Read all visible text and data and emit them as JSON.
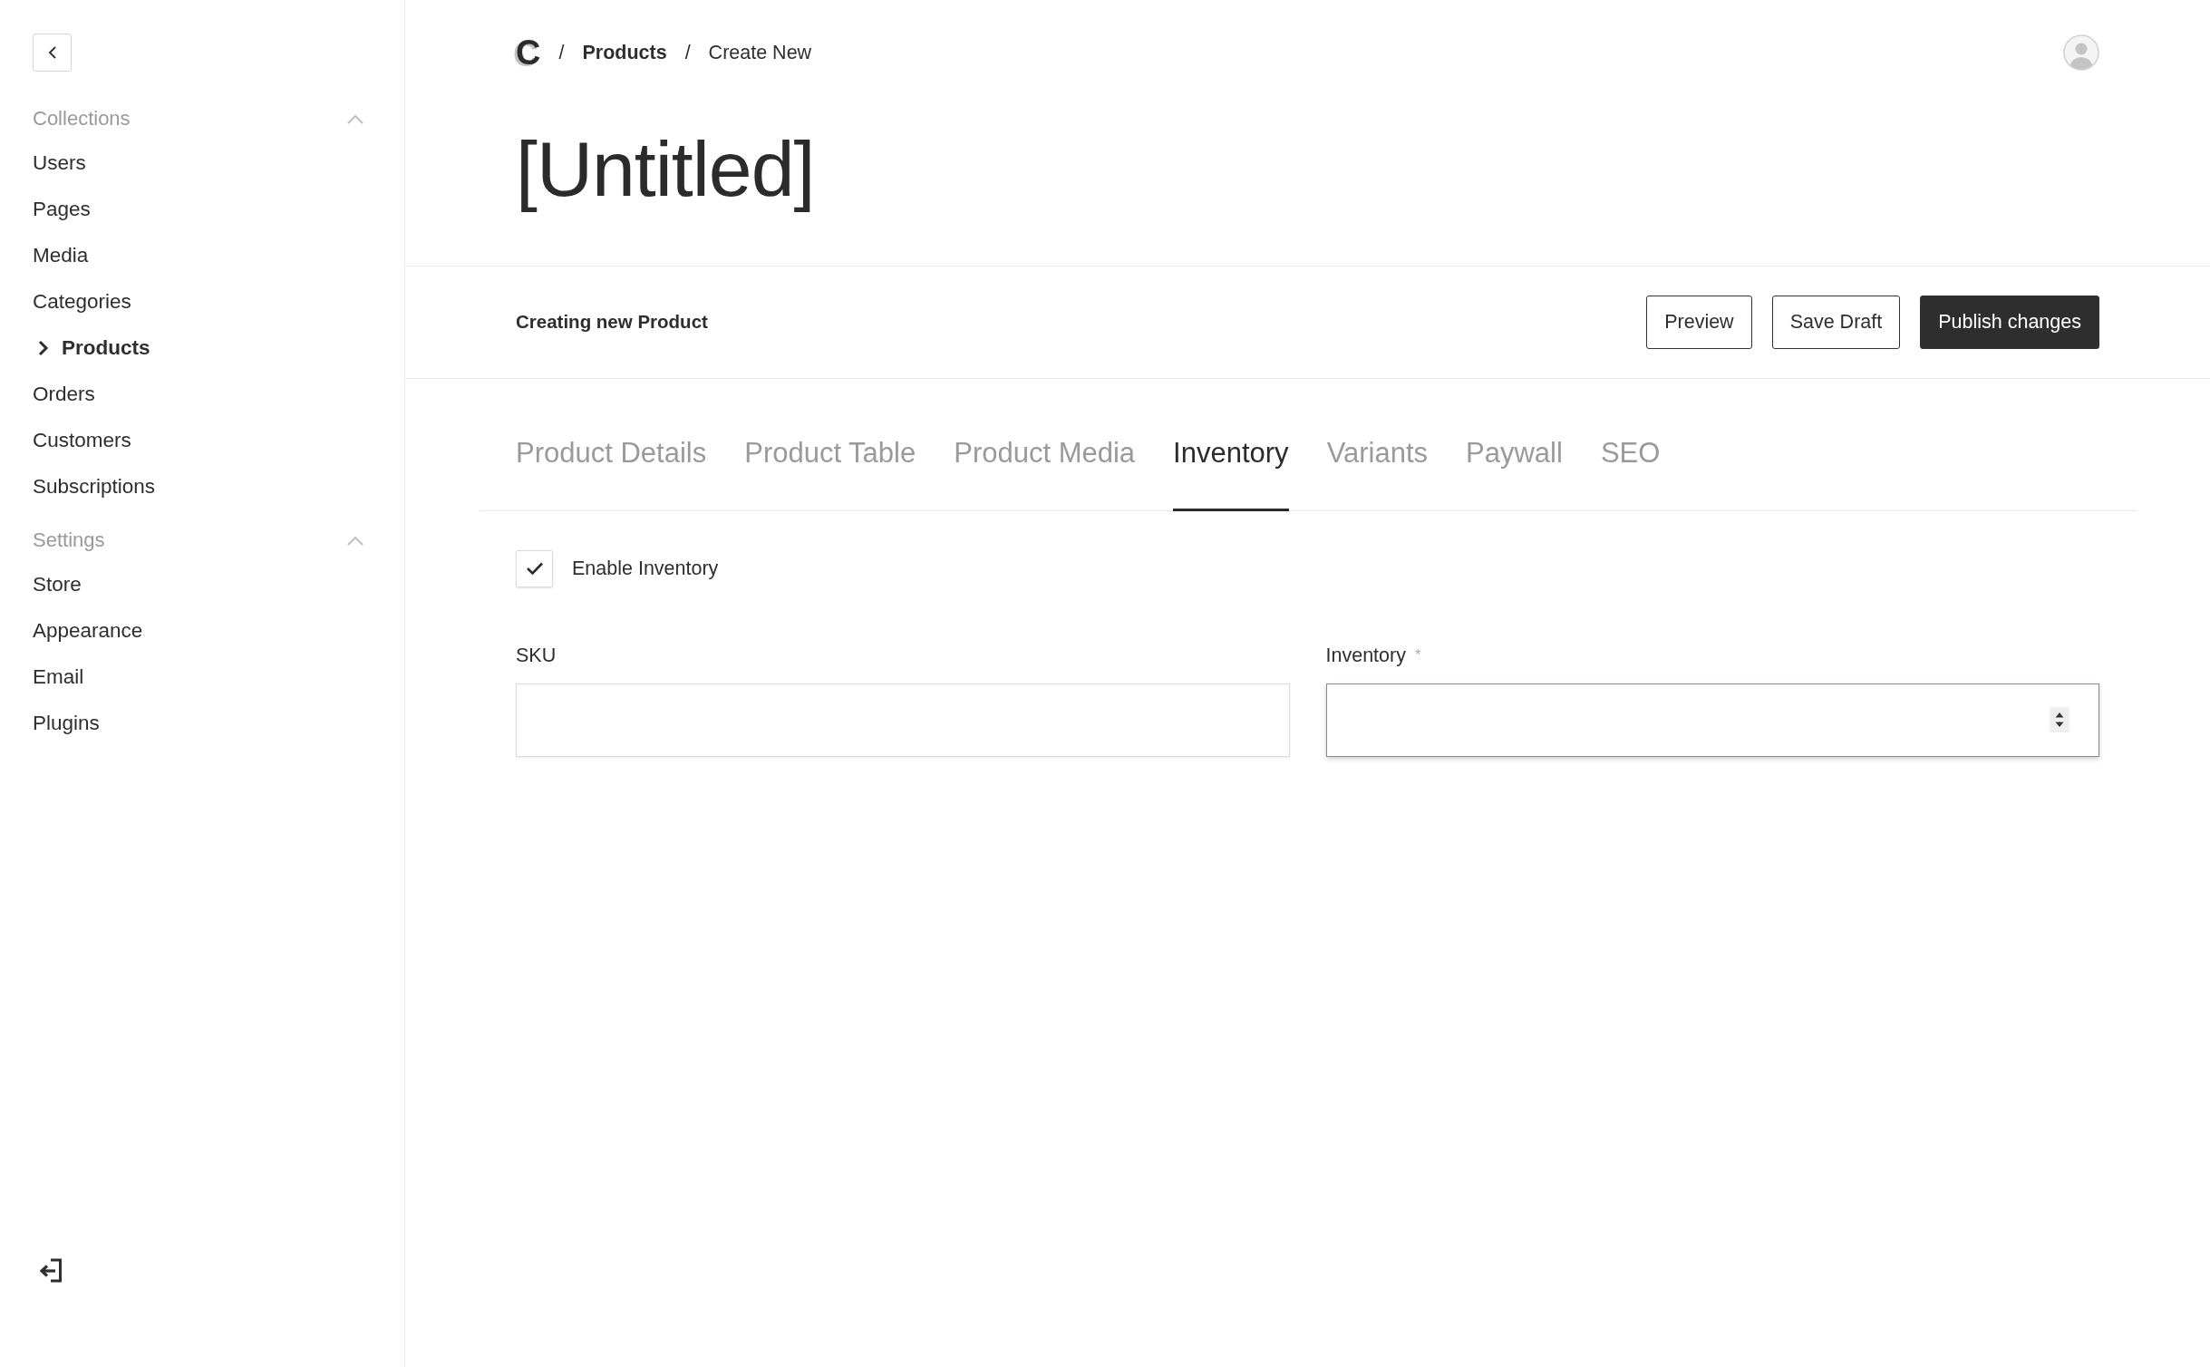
{
  "sidebar": {
    "groups": [
      {
        "label": "Collections",
        "expanded": true,
        "items": [
          {
            "label": "Users",
            "selected": false
          },
          {
            "label": "Pages",
            "selected": false
          },
          {
            "label": "Media",
            "selected": false
          },
          {
            "label": "Categories",
            "selected": false
          },
          {
            "label": "Products",
            "selected": true
          },
          {
            "label": "Orders",
            "selected": false
          },
          {
            "label": "Customers",
            "selected": false
          },
          {
            "label": "Subscriptions",
            "selected": false
          }
        ]
      },
      {
        "label": "Settings",
        "expanded": true,
        "items": [
          {
            "label": "Store",
            "selected": false
          },
          {
            "label": "Appearance",
            "selected": false
          },
          {
            "label": "Email",
            "selected": false
          },
          {
            "label": "Plugins",
            "selected": false
          }
        ]
      }
    ]
  },
  "breadcrumb": [
    {
      "kind": "logo",
      "label": "C"
    },
    {
      "kind": "separator",
      "label": "/"
    },
    {
      "kind": "link",
      "label": "Products"
    },
    {
      "kind": "separator",
      "label": "/"
    },
    {
      "kind": "current",
      "label": "Create New"
    }
  ],
  "title": "[Untitled]",
  "toolbar": {
    "status": "Creating new Product",
    "buttons": [
      {
        "label": "Preview",
        "kind": "outline"
      },
      {
        "label": "Save Draft",
        "kind": "outline"
      },
      {
        "label": "Publish changes",
        "kind": "primary"
      }
    ]
  },
  "tabs": [
    {
      "label": "Product Details",
      "selected": false
    },
    {
      "label": "Product Table",
      "selected": false
    },
    {
      "label": "Product Media",
      "selected": false
    },
    {
      "label": "Inventory",
      "selected": true
    },
    {
      "label": "Variants",
      "selected": false
    },
    {
      "label": "Paywall",
      "selected": false
    },
    {
      "label": "SEO",
      "selected": false
    }
  ],
  "form": {
    "enable": {
      "label": "Enable Inventory",
      "checked": true
    },
    "fields": [
      {
        "label": "SKU",
        "kind": "text",
        "focused": false
      },
      {
        "label": "Inventory",
        "required_mark": "*",
        "kind": "number",
        "focused": true
      }
    ]
  }
}
